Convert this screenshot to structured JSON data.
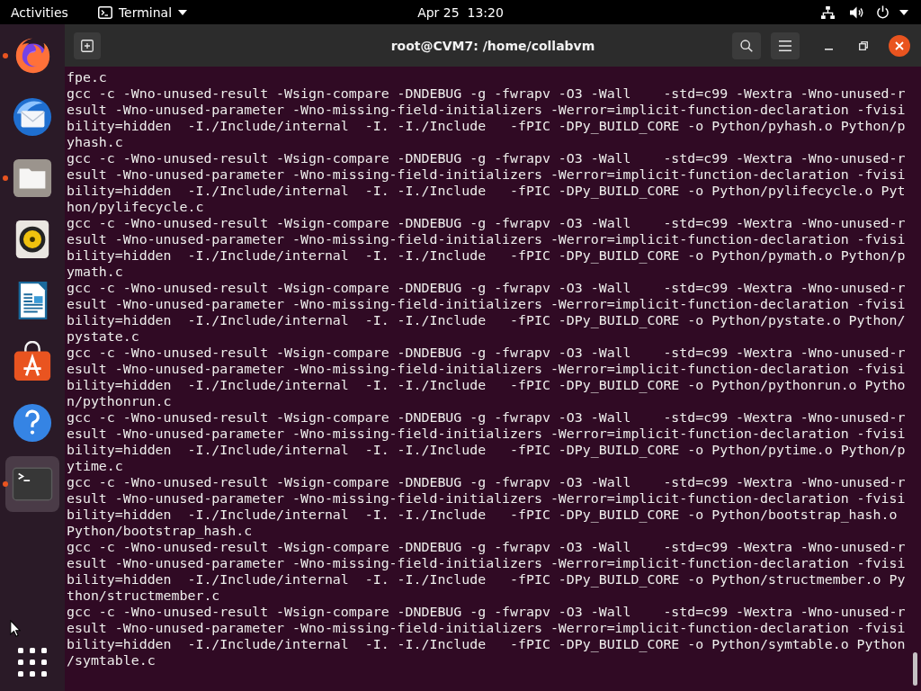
{
  "top_bar": {
    "activities": "Activities",
    "app_menu": "Terminal",
    "clock": "Apr 25  13:20"
  },
  "dock": {
    "items": [
      {
        "running": true,
        "selected": false
      },
      {
        "running": false,
        "selected": false
      },
      {
        "running": true,
        "selected": false
      },
      {
        "running": false,
        "selected": false
      },
      {
        "running": false,
        "selected": false
      },
      {
        "running": false,
        "selected": false
      },
      {
        "running": false,
        "selected": false
      },
      {
        "running": true,
        "selected": true
      }
    ]
  },
  "window": {
    "title": "root@CVM7: /home/collabvm"
  },
  "terminal": {
    "lines": [
      "fpe.c",
      "gcc -c -Wno-unused-result -Wsign-compare -DNDEBUG -g -fwrapv -O3 -Wall    -std=c99 -Wextra -Wno-unused-r",
      "esult -Wno-unused-parameter -Wno-missing-field-initializers -Werror=implicit-function-declaration -fvisi",
      "bility=hidden  -I./Include/internal  -I. -I./Include   -fPIC -DPy_BUILD_CORE -o Python/pyhash.o Python/p",
      "yhash.c",
      "gcc -c -Wno-unused-result -Wsign-compare -DNDEBUG -g -fwrapv -O3 -Wall    -std=c99 -Wextra -Wno-unused-r",
      "esult -Wno-unused-parameter -Wno-missing-field-initializers -Werror=implicit-function-declaration -fvisi",
      "bility=hidden  -I./Include/internal  -I. -I./Include   -fPIC -DPy_BUILD_CORE -o Python/pylifecycle.o Pyt",
      "hon/pylifecycle.c",
      "gcc -c -Wno-unused-result -Wsign-compare -DNDEBUG -g -fwrapv -O3 -Wall    -std=c99 -Wextra -Wno-unused-r",
      "esult -Wno-unused-parameter -Wno-missing-field-initializers -Werror=implicit-function-declaration -fvisi",
      "bility=hidden  -I./Include/internal  -I. -I./Include   -fPIC -DPy_BUILD_CORE -o Python/pymath.o Python/p",
      "ymath.c",
      "gcc -c -Wno-unused-result -Wsign-compare -DNDEBUG -g -fwrapv -O3 -Wall    -std=c99 -Wextra -Wno-unused-r",
      "esult -Wno-unused-parameter -Wno-missing-field-initializers -Werror=implicit-function-declaration -fvisi",
      "bility=hidden  -I./Include/internal  -I. -I./Include   -fPIC -DPy_BUILD_CORE -o Python/pystate.o Python/",
      "pystate.c",
      "gcc -c -Wno-unused-result -Wsign-compare -DNDEBUG -g -fwrapv -O3 -Wall    -std=c99 -Wextra -Wno-unused-r",
      "esult -Wno-unused-parameter -Wno-missing-field-initializers -Werror=implicit-function-declaration -fvisi",
      "bility=hidden  -I./Include/internal  -I. -I./Include   -fPIC -DPy_BUILD_CORE -o Python/pythonrun.o Pytho",
      "n/pythonrun.c",
      "gcc -c -Wno-unused-result -Wsign-compare -DNDEBUG -g -fwrapv -O3 -Wall    -std=c99 -Wextra -Wno-unused-r",
      "esult -Wno-unused-parameter -Wno-missing-field-initializers -Werror=implicit-function-declaration -fvisi",
      "bility=hidden  -I./Include/internal  -I. -I./Include   -fPIC -DPy_BUILD_CORE -o Python/pytime.o Python/p",
      "ytime.c",
      "gcc -c -Wno-unused-result -Wsign-compare -DNDEBUG -g -fwrapv -O3 -Wall    -std=c99 -Wextra -Wno-unused-r",
      "esult -Wno-unused-parameter -Wno-missing-field-initializers -Werror=implicit-function-declaration -fvisi",
      "bility=hidden  -I./Include/internal  -I. -I./Include   -fPIC -DPy_BUILD_CORE -o Python/bootstrap_hash.o",
      "Python/bootstrap_hash.c",
      "gcc -c -Wno-unused-result -Wsign-compare -DNDEBUG -g -fwrapv -O3 -Wall    -std=c99 -Wextra -Wno-unused-r",
      "esult -Wno-unused-parameter -Wno-missing-field-initializers -Werror=implicit-function-declaration -fvisi",
      "bility=hidden  -I./Include/internal  -I. -I./Include   -fPIC -DPy_BUILD_CORE -o Python/structmember.o Py",
      "thon/structmember.c",
      "gcc -c -Wno-unused-result -Wsign-compare -DNDEBUG -g -fwrapv -O3 -Wall    -std=c99 -Wextra -Wno-unused-r",
      "esult -Wno-unused-parameter -Wno-missing-field-initializers -Werror=implicit-function-declaration -fvisi",
      "bility=hidden  -I./Include/internal  -I. -I./Include   -fPIC -DPy_BUILD_CORE -o Python/symtable.o Python",
      "/symtable.c"
    ]
  }
}
